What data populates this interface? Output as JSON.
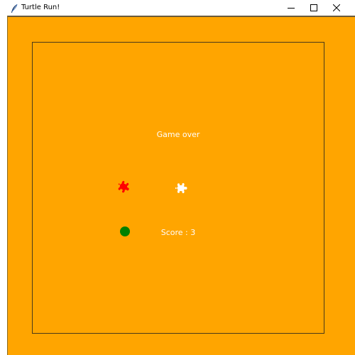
{
  "window": {
    "title": "Turtle Run!",
    "controls": {
      "minimize": "minimize-icon",
      "maximize": "maximize-icon",
      "close": "close-icon"
    }
  },
  "game": {
    "status_text": "Game over",
    "score_text": "Score : 3",
    "colors": {
      "background": "#ffa500",
      "border": "#4a3a1a",
      "text": "#ffffff",
      "enemy_turtle": "#ff0000",
      "player_turtle": "#ffffff",
      "food": "#008000"
    },
    "sprites": {
      "enemy": "turtle-icon",
      "player": "turtle-icon",
      "food": "circle-icon"
    }
  }
}
